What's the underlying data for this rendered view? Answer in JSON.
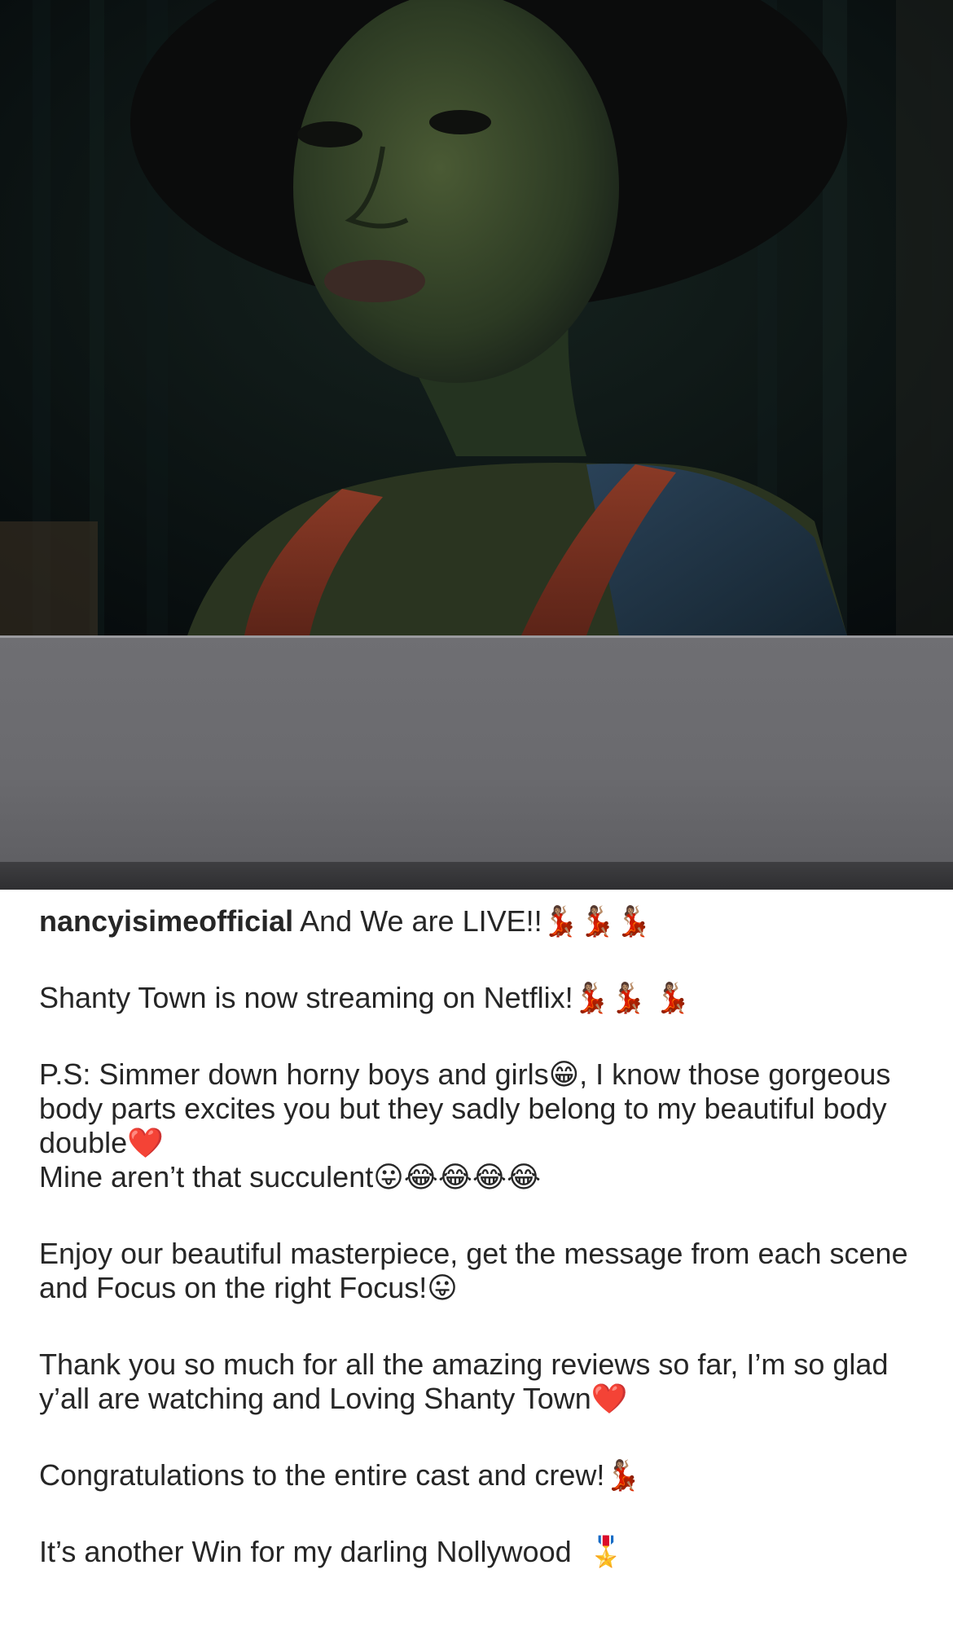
{
  "post": {
    "username": "nancyisimeofficial",
    "paragraphs": [
      "And We are LIVE!!💃🏽💃🏽💃🏽",
      "Shanty Town is now streaming on Netflix!💃🏽💃🏽 💃🏽",
      "P.S: Simmer down horny boys and girls😁, I know those gorgeous body parts excites you but they sadly belong to my beautiful body double❤️\nMine aren’t that succulent😛😂😂😂😂",
      "Enjoy our beautiful masterpiece, get the message from each scene and Focus on the right Focus!😛",
      "Thank you so much for all the amazing reviews so far, I’m so glad y’all are watching and Loving Shanty Town❤️",
      "Congratulations to the entire cast and crew!💃🏽",
      "It’s another Win for my darling Nollywood  🎖️"
    ]
  },
  "media": {
    "photo_description_icon": "portrait-photo",
    "redaction_panel_color": "#6b6b6f"
  }
}
